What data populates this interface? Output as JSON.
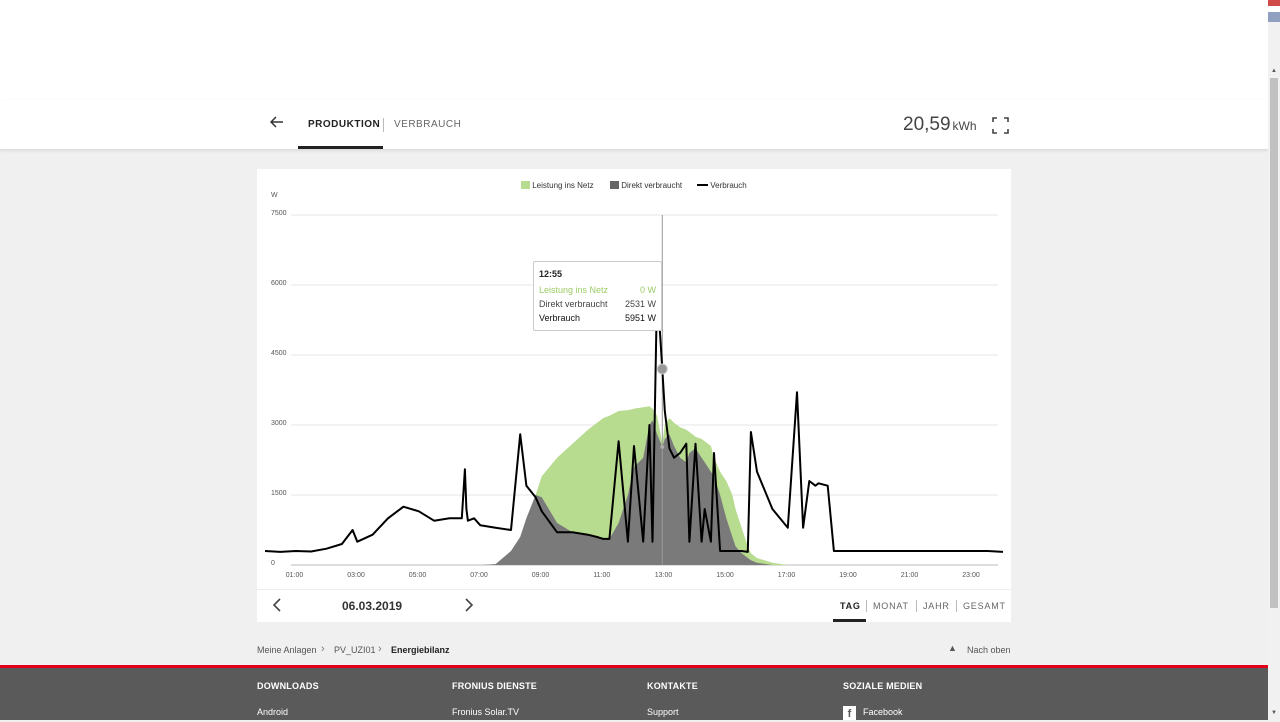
{
  "header": {
    "tabs": [
      {
        "label": "PRODUKTION",
        "active": true
      },
      {
        "label": "VERBRAUCH",
        "active": false
      }
    ],
    "energy_value": "20,59",
    "energy_unit": "kWh",
    "icons": [
      "arrow-left-icon",
      "fullscreen-icon"
    ]
  },
  "chart_data": {
    "type": "area",
    "ylabel": "W",
    "ylim": [
      0,
      7500
    ],
    "yticks": [
      "0",
      "1500",
      "3000",
      "4500",
      "6000",
      "7500"
    ],
    "xticks": [
      "01:00",
      "03:00",
      "05:00",
      "07:00",
      "09:00",
      "11:00",
      "13:00",
      "15:00",
      "17:00",
      "19:00",
      "21:00",
      "23:00"
    ],
    "legend_position": "top-center",
    "grid": true,
    "x": [
      0.0,
      0.5,
      1.0,
      1.5,
      2.0,
      2.5,
      2.85,
      3.0,
      3.5,
      4.0,
      4.5,
      5.0,
      5.5,
      6.0,
      6.4,
      6.5,
      6.55,
      6.6,
      6.8,
      7.0,
      7.5,
      8.0,
      8.3,
      8.5,
      8.8,
      9.0,
      9.5,
      10.0,
      10.5,
      10.8,
      11.0,
      11.2,
      11.5,
      11.8,
      12.0,
      12.3,
      12.5,
      12.6,
      12.75,
      12.92,
      13.0,
      13.15,
      13.3,
      13.5,
      13.7,
      13.8,
      14.0,
      14.2,
      14.3,
      14.5,
      14.6,
      14.8,
      15.0,
      15.2,
      15.3,
      15.5,
      15.7,
      15.8,
      16.0,
      16.5,
      17.0,
      17.3,
      17.5,
      17.7,
      17.9,
      18.0,
      18.3,
      18.5,
      18.8,
      19.0,
      19.1,
      19.2,
      19.3,
      19.45,
      19.5,
      19.7,
      19.9,
      20.0,
      20.2,
      20.4,
      20.5,
      21.0,
      21.3,
      21.5,
      21.7,
      22.0,
      22.5,
      23.0,
      23.5,
      24.0
    ],
    "series": [
      {
        "name": "Leistung ins Netz",
        "color": "#b7db8f",
        "values": [
          0,
          0,
          0,
          0,
          0,
          0,
          0,
          0,
          0,
          0,
          0,
          0,
          0,
          0,
          0,
          0,
          0,
          0,
          0,
          0,
          20,
          300,
          600,
          1000,
          1500,
          1900,
          2300,
          2600,
          2900,
          3050,
          3150,
          3200,
          3300,
          3320,
          3350,
          3380,
          3400,
          3350,
          3200,
          2600,
          3000,
          3150,
          3050,
          2950,
          2900,
          2850,
          2750,
          2700,
          2650,
          2550,
          2300,
          2000,
          1800,
          1500,
          1200,
          800,
          400,
          250,
          150,
          50,
          0,
          0,
          0,
          0,
          0,
          0,
          0,
          0,
          0,
          0,
          0,
          0,
          0,
          0,
          0,
          0,
          0,
          0,
          0,
          0,
          0,
          0,
          0,
          0,
          0,
          0,
          0,
          0,
          0,
          0
        ]
      },
      {
        "name": "Direkt verbraucht",
        "color": "#7a7a7a",
        "values": [
          0,
          0,
          0,
          0,
          0,
          0,
          0,
          0,
          0,
          0,
          0,
          0,
          0,
          0,
          0,
          0,
          0,
          0,
          0,
          0,
          20,
          300,
          600,
          1000,
          1500,
          1450,
          900,
          700,
          650,
          600,
          580,
          560,
          900,
          1500,
          2100,
          2300,
          3000,
          3100,
          2800,
          2531,
          2700,
          2800,
          2550,
          2300,
          2200,
          2400,
          2500,
          2300,
          2200,
          2000,
          1900,
          1500,
          1000,
          600,
          400,
          250,
          150,
          100,
          50,
          0,
          0,
          0,
          0,
          0,
          0,
          0,
          0,
          0,
          0,
          0,
          0,
          0,
          0,
          0,
          0,
          0,
          0,
          0,
          0,
          0,
          0,
          0,
          0,
          0,
          0,
          0,
          0,
          0,
          0,
          0
        ]
      },
      {
        "name": "Verbrauch",
        "color": "#000000",
        "values": [
          300,
          280,
          300,
          290,
          350,
          450,
          750,
          500,
          650,
          1000,
          1250,
          1150,
          950,
          1000,
          1000,
          2050,
          1200,
          950,
          1000,
          850,
          800,
          750,
          2800,
          1700,
          1450,
          1150,
          700,
          700,
          650,
          600,
          560,
          560,
          2650,
          500,
          2550,
          500,
          3000,
          500,
          5951,
          4200,
          3300,
          2500,
          2300,
          2400,
          2600,
          500,
          2600,
          500,
          1200,
          500,
          2400,
          300,
          300,
          300,
          300,
          300,
          280,
          2850,
          2000,
          1200,
          800,
          3700,
          800,
          1800,
          1700,
          1750,
          1700,
          300,
          300,
          300,
          300,
          300,
          300,
          300,
          300,
          300,
          300,
          300,
          300,
          300,
          300,
          300,
          300,
          300,
          300,
          300,
          300,
          300,
          300,
          280
        ]
      }
    ],
    "tooltip": {
      "time": "12:55",
      "rows": [
        {
          "label": "Leistung ins Netz",
          "value": "0 W"
        },
        {
          "label": "Direkt verbraucht",
          "value": "2531 W"
        },
        {
          "label": "Verbrauch",
          "value": "5951 W"
        }
      ]
    }
  },
  "navigation": {
    "date": "06.03.2019",
    "periods": [
      "TAG",
      "MONAT",
      "JAHR",
      "GESAMT"
    ],
    "active_period": "TAG"
  },
  "breadcrumb": {
    "items": [
      "Meine Anlagen",
      "PV_UZI01",
      "Energiebilanz"
    ],
    "back_to_top": "Nach oben"
  },
  "footer": {
    "columns": [
      {
        "heading": "DOWNLOADS",
        "link": "Android"
      },
      {
        "heading": "FRONIUS DIENSTE",
        "link": "Fronius Solar.TV"
      },
      {
        "heading": "KONTAKTE",
        "link": "Support"
      },
      {
        "heading": "SOZIALE MEDIEN",
        "link": "Facebook"
      }
    ]
  },
  "colors": {
    "accent_red": "#e2001a",
    "footer_bg": "#5a5a5a",
    "green": "#b7db8f",
    "grey_area": "#7a7a7a"
  }
}
